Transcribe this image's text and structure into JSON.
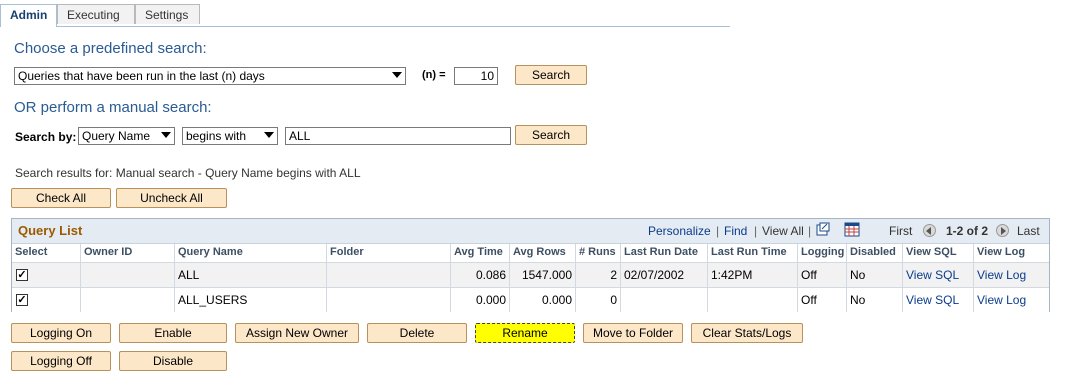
{
  "tabs": [
    {
      "label": "Admin",
      "active": true
    },
    {
      "label": "Executing",
      "active": false
    },
    {
      "label": "Settings",
      "active": false
    }
  ],
  "predefined": {
    "heading": "Choose a predefined search:",
    "select_value": "Queries that have been run in the last (n) days",
    "n_label": "(n) =",
    "n_value": "10",
    "search_button": "Search"
  },
  "manual": {
    "heading": "OR perform a manual search:",
    "search_by_label": "Search by:",
    "field_select": "Query Name",
    "operator_select": "begins with",
    "value": "ALL",
    "search_button": "Search"
  },
  "results_text": "Search results for: Manual search - Query Name begins with ALL",
  "check_all": "Check All",
  "uncheck_all": "Uncheck All",
  "grid": {
    "title": "Query List",
    "personalize": "Personalize",
    "find": "Find",
    "separator": "|",
    "view_all": "View All",
    "first": "First",
    "range": "1-2 of 2",
    "last": "Last",
    "columns": [
      "Select",
      "Owner ID",
      "Query Name",
      "Folder",
      "Avg Time",
      "Avg Rows",
      "# Runs",
      "Last Run Date",
      "Last Run Time",
      "Logging",
      "Disabled",
      "View SQL",
      "View Log"
    ],
    "rows": [
      {
        "checked": true,
        "owner": "",
        "name": "ALL",
        "folder": "",
        "avg_time": "0.086",
        "avg_rows": "1547.000",
        "runs": "2",
        "last_date": "02/07/2002",
        "last_time": "1:42PM",
        "logging": "Off",
        "disabled": "No",
        "view_sql": "View SQL",
        "view_log": "View Log"
      },
      {
        "checked": true,
        "owner": "",
        "name": "ALL_USERS",
        "folder": "",
        "avg_time": "0.000",
        "avg_rows": "0.000",
        "runs": "0",
        "last_date": "",
        "last_time": "",
        "logging": "Off",
        "disabled": "No",
        "view_sql": "View SQL",
        "view_log": "View Log"
      }
    ]
  },
  "actions": {
    "logging_on": "Logging On",
    "enable": "Enable",
    "assign_new_owner": "Assign New Owner",
    "delete": "Delete",
    "rename": "Rename",
    "move_to_folder": "Move to Folder",
    "clear_stats": "Clear Stats/Logs",
    "logging_off": "Logging Off",
    "disable": "Disable"
  },
  "colors": {
    "highlight": "#ffff00",
    "button_bg": "#fce7c8",
    "heading": "#2a5b93",
    "link": "#0a3c8c"
  }
}
